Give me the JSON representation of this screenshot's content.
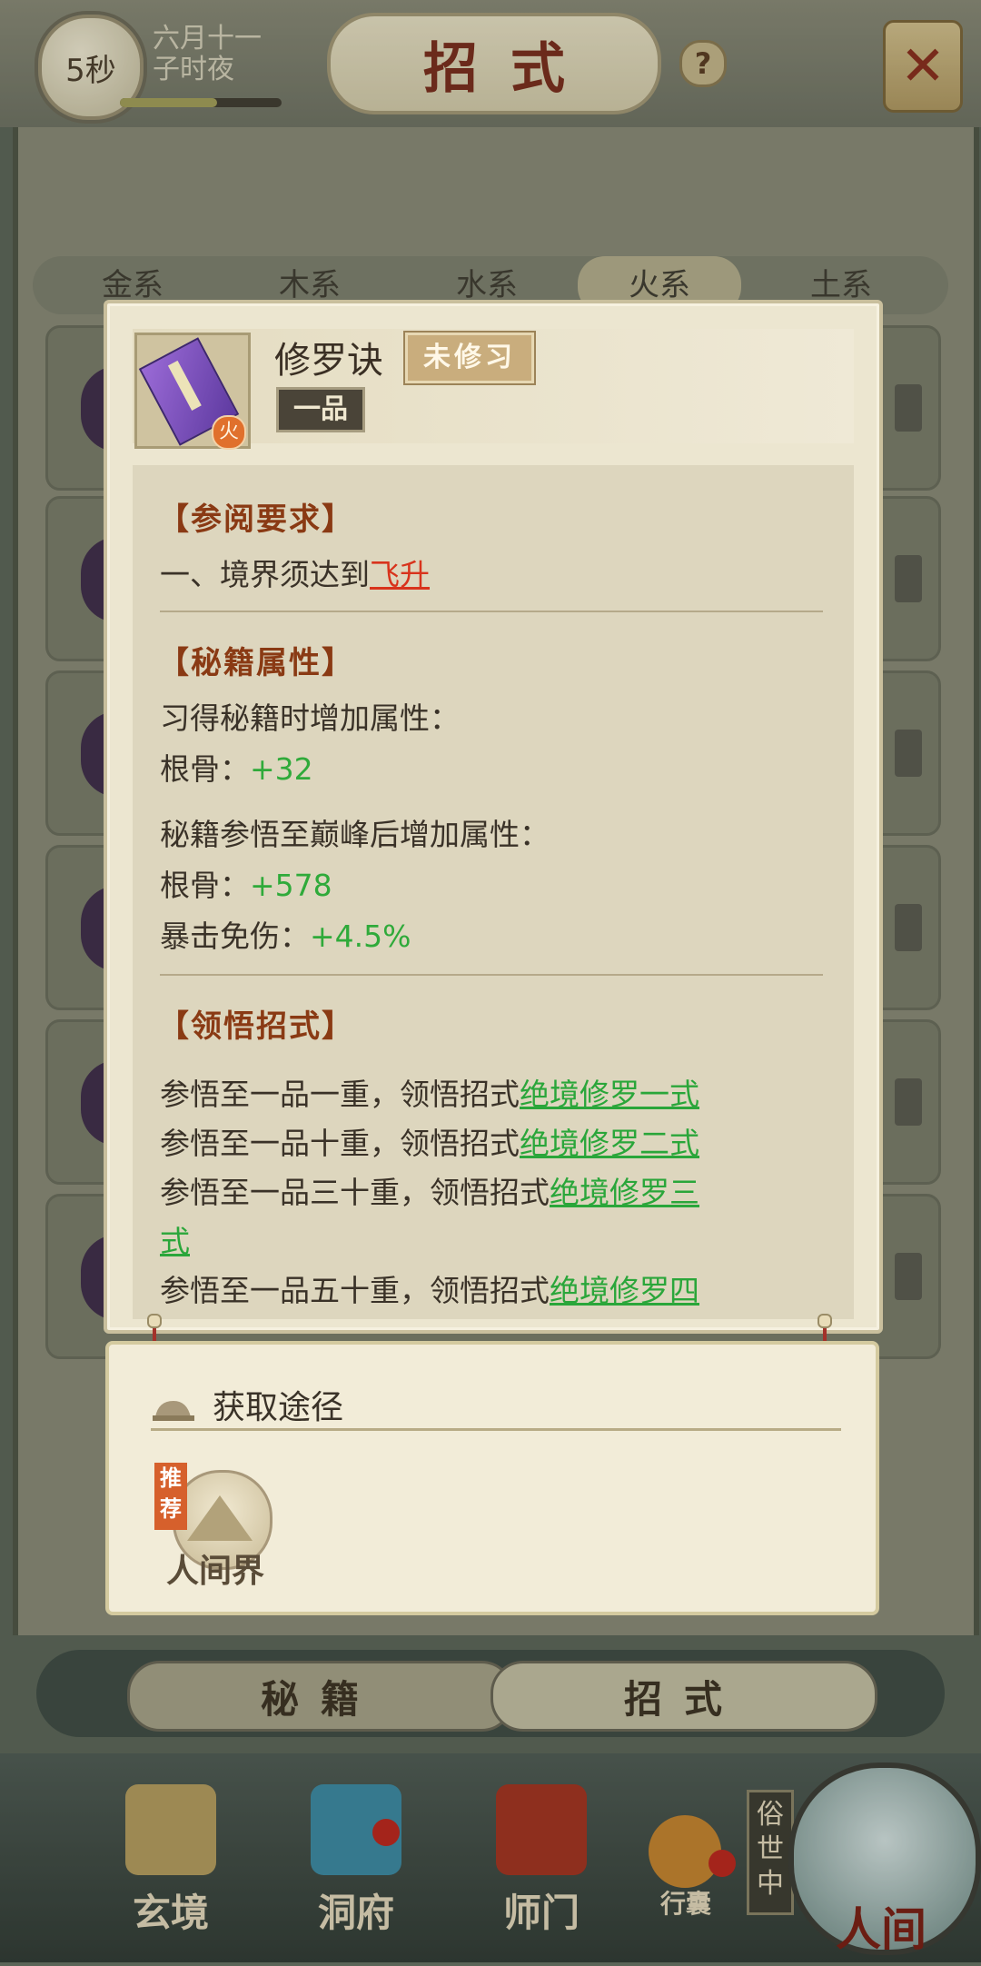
{
  "header": {
    "timer": "5秒",
    "date_line1": "六月十一",
    "date_line2": "子时夜",
    "title": "招式",
    "help": "?",
    "close": "✕"
  },
  "element_tabs": [
    "金系",
    "木系",
    "水系",
    "火系",
    "土系"
  ],
  "popup": {
    "skill_name": "修罗诀",
    "status": "未修习",
    "grade": "一品",
    "element_badge": "火",
    "requirements": {
      "title": "【参阅要求】",
      "line_prefix": "一、境界须达到",
      "line_link": "飞升"
    },
    "attributes": {
      "title": "【秘籍属性】",
      "learn_header": "习得秘籍时增加属性：",
      "learn_label": "根骨：",
      "learn_value": "+32",
      "peak_header": "秘籍参悟至巅峰后增加属性：",
      "peak_label1": "根骨：",
      "peak_value1": "+578",
      "peak_label2": "暴击免伤：",
      "peak_value2": "+4.5%"
    },
    "insights": {
      "title": "【领悟招式】",
      "items": [
        {
          "prefix": "参悟至一品一重，领悟招式",
          "link": "绝境修罗一式"
        },
        {
          "prefix": "参悟至一品十重，领悟招式",
          "link": "绝境修罗二式"
        },
        {
          "prefix": "参悟至一品三十重，领悟招式",
          "link": "绝境修罗三",
          "link_cont": "式"
        },
        {
          "prefix": "参悟至一品五十重，领悟招式",
          "link": "绝境修罗四"
        }
      ]
    }
  },
  "acquisition": {
    "title": "获取途径",
    "recommend": "推荐",
    "source": "人间界"
  },
  "bottom_tabs": {
    "tab1": "秘籍",
    "tab2": "招式"
  },
  "nav": {
    "item1": "玄境",
    "item2": "洞府",
    "item3": "师门",
    "item4": "行囊",
    "vertical_tag": "俗世中",
    "realm": "人间"
  }
}
